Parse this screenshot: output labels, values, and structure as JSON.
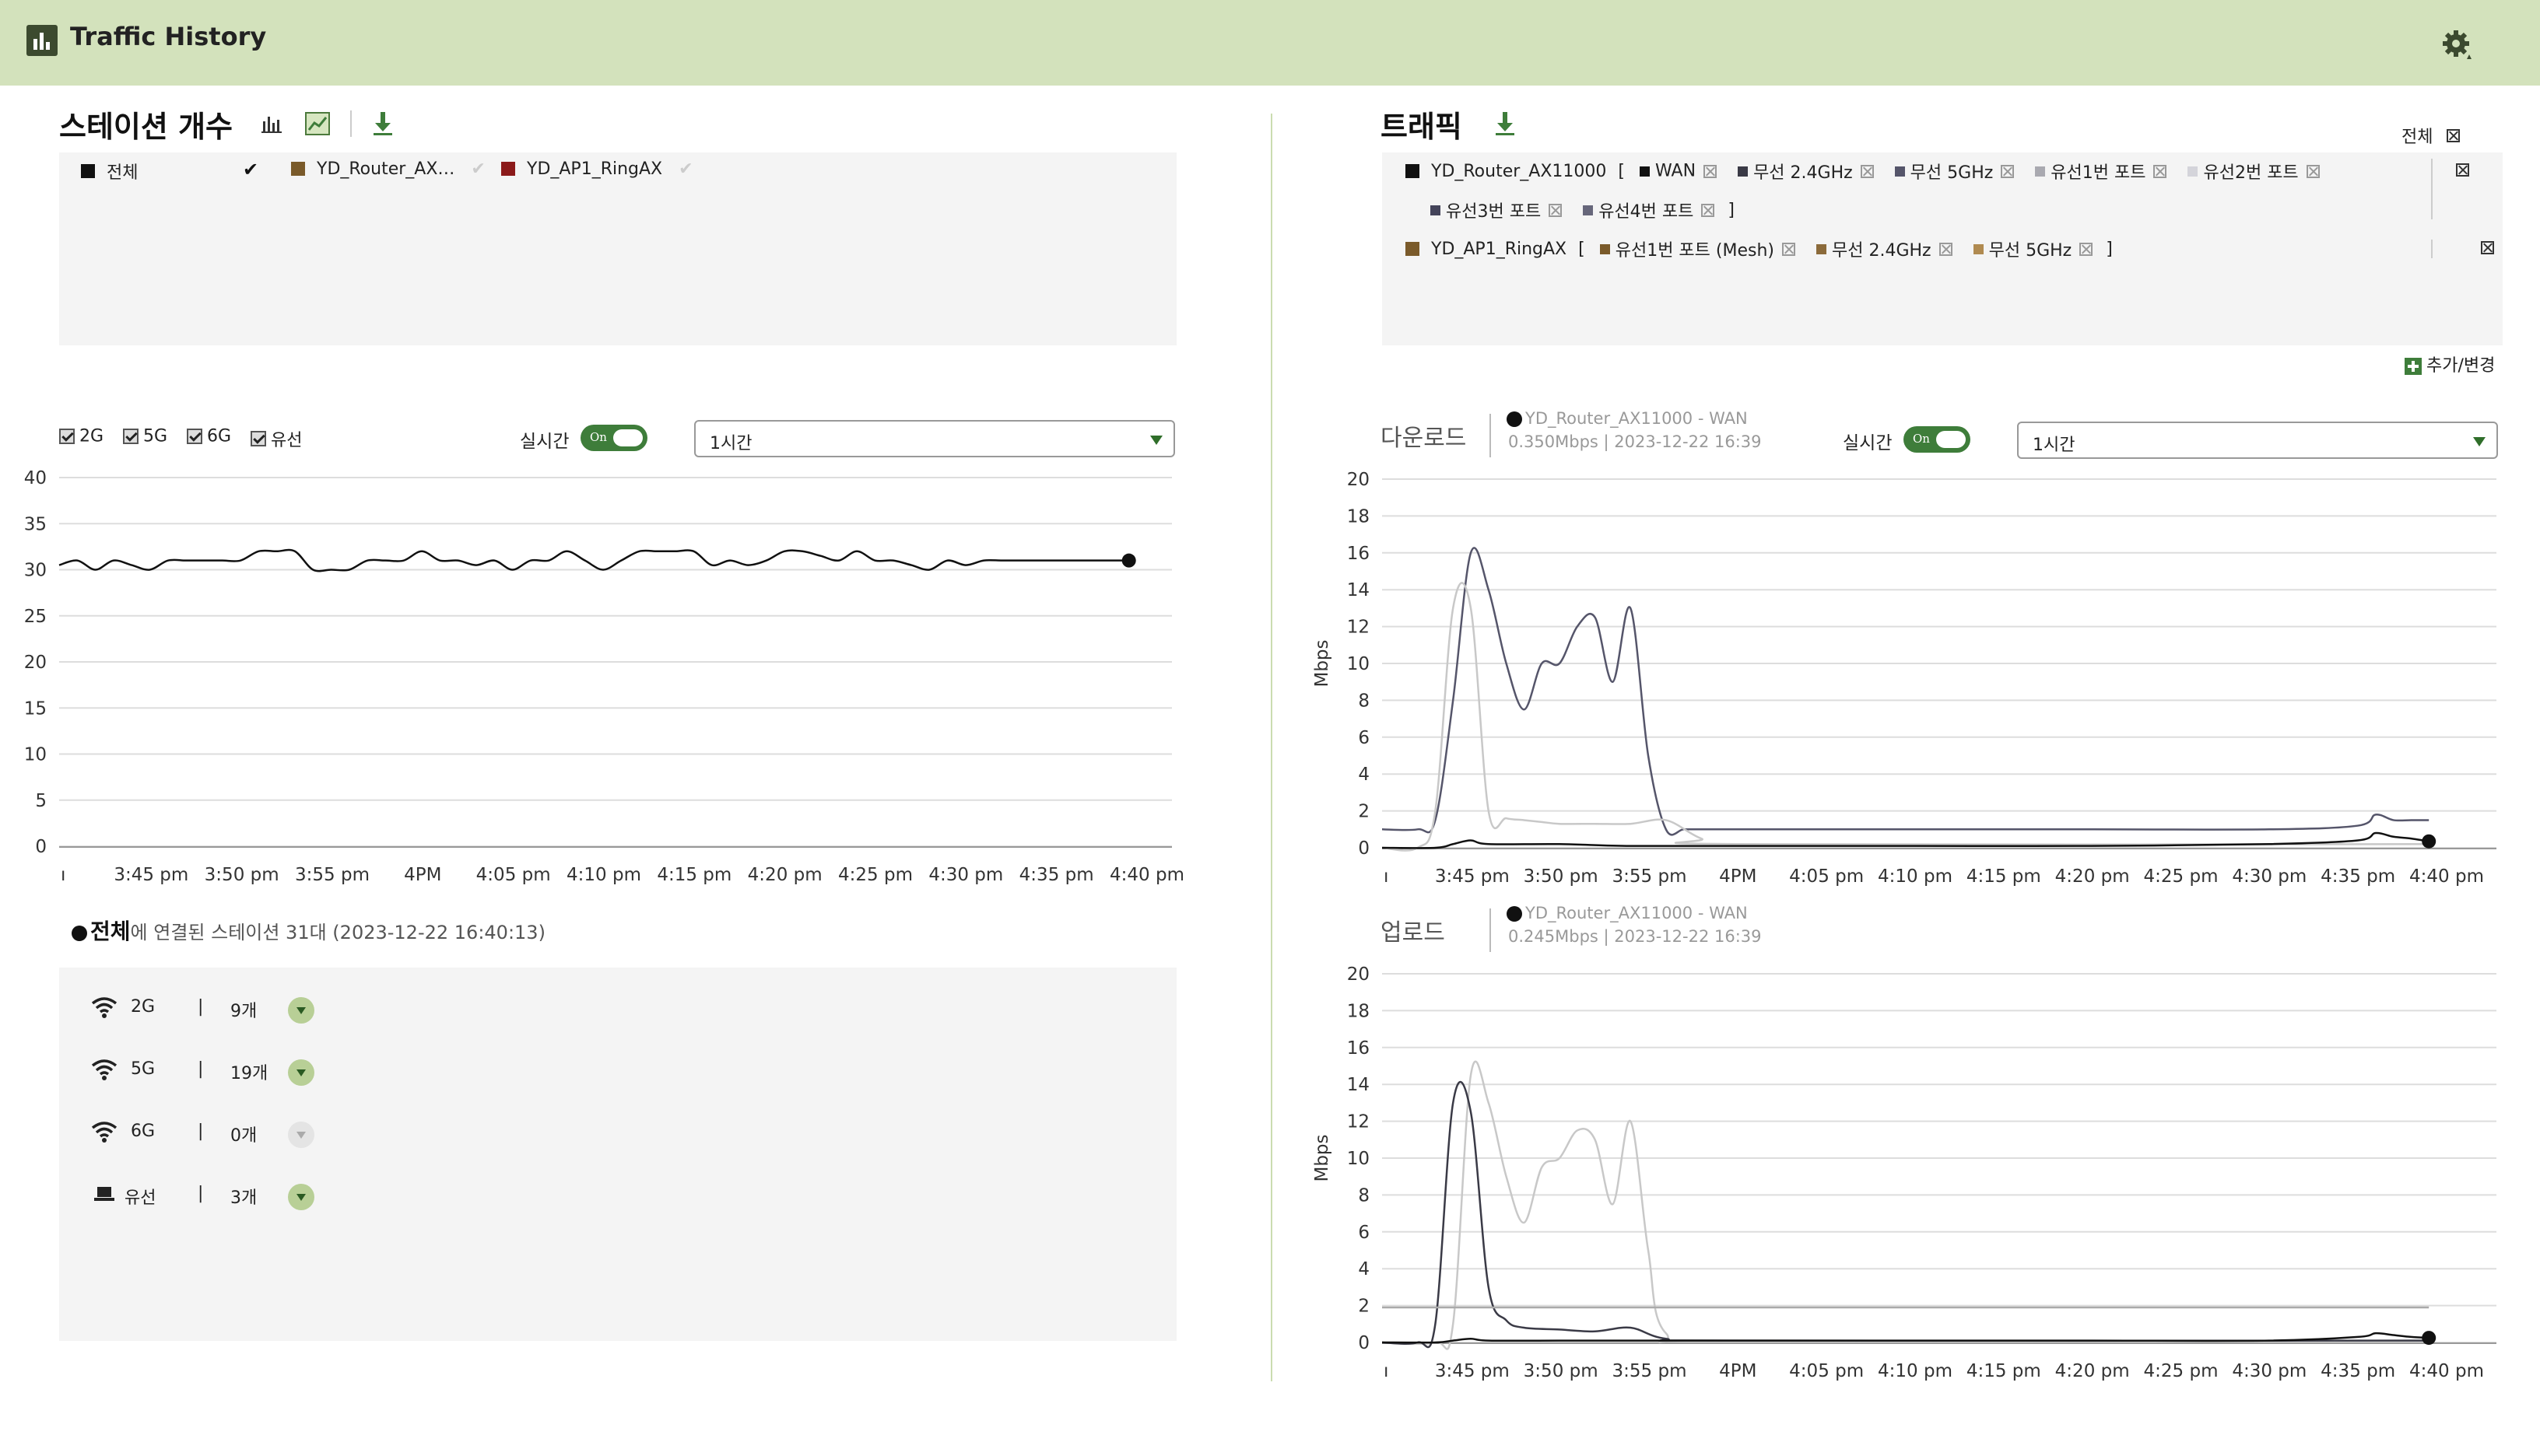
{
  "header": {
    "title": "Traffic History",
    "logo_icon": "bar-chart-icon",
    "settings_icon": "gear-icon"
  },
  "stations": {
    "title": "스테이션 개수",
    "tools": [
      "bar-chart-icon",
      "line-chart-icon",
      "download-icon"
    ],
    "legend": [
      {
        "label": "전체",
        "color": "#111111",
        "checked": true
      },
      {
        "label": "YD_Router_AX…",
        "color": "#7a5a2a",
        "checked": false
      },
      {
        "label": "YD_AP1_RingAX",
        "color": "#8b1a1a",
        "checked": false
      }
    ],
    "filters": [
      "2G",
      "5G",
      "6G",
      "유선"
    ],
    "realtime_label": "실시간",
    "toggle_text": "On",
    "range": "1시간",
    "summary_bold": "전체",
    "summary_text": "에 연결된 스테이션 31대 (2023-12-22 16:40:13)",
    "counts": [
      {
        "icon": "wifi-icon",
        "label": "2G",
        "sep": "|",
        "count": "9개",
        "enabled": true
      },
      {
        "icon": "wifi-icon",
        "label": "5G",
        "sep": "|",
        "count": "19개",
        "enabled": true
      },
      {
        "icon": "wifi-icon",
        "label": "6G",
        "sep": "|",
        "count": "0개",
        "enabled": false
      },
      {
        "icon": "laptop-icon",
        "label": "유선",
        "sep": "|",
        "count": "3개",
        "enabled": true
      }
    ]
  },
  "traffic": {
    "title": "트래픽",
    "all_label": "전체",
    "devices": [
      {
        "name": "YD_Router_AX11000",
        "color": "#111111",
        "open": "[",
        "close": "]",
        "ports": [
          {
            "label": "WAN",
            "color": "#111111"
          },
          {
            "label": "무선 2.4GHz",
            "color": "#3a3a46"
          },
          {
            "label": "무선 5GHz",
            "color": "#55556a"
          },
          {
            "label": "유선1번 포트",
            "color": "#a9a9b0"
          },
          {
            "label": "유선2번 포트",
            "color": "#d4d4da"
          },
          {
            "label": "유선3번 포트",
            "color": "#44445a"
          },
          {
            "label": "유선4번 포트",
            "color": "#66667a"
          }
        ]
      },
      {
        "name": "YD_AP1_RingAX",
        "color": "#7a5a2a",
        "open": "[",
        "close": "]",
        "ports": [
          {
            "label": "유선1번 포트 (Mesh)",
            "color": "#7a5a2a"
          },
          {
            "label": "무선 2.4GHz",
            "color": "#8b6a3a"
          },
          {
            "label": "무선 5GHz",
            "color": "#b08a50"
          }
        ]
      }
    ],
    "add_label": "추가/변경",
    "download": {
      "title": "다운로드",
      "series": "YD_Router_AX11000 - WAN",
      "value": "0.350Mbps | 2023-12-22 16:39"
    },
    "upload": {
      "title": "업로드",
      "series": "YD_Router_AX11000 - WAN",
      "value": "0.245Mbps | 2023-12-22 16:39"
    },
    "realtime_label": "실시간",
    "toggle_text": "On",
    "range": "1시간"
  },
  "chart_data": [
    {
      "type": "line",
      "x_tick_labels": [
        "ı",
        "3:45 pm",
        "3:50 pm",
        "3:55 pm",
        "4PM",
        "4:05 pm",
        "4:10 pm",
        "4:15 pm",
        "4:20 pm",
        "4:25 pm",
        "4:30 pm",
        "4:35 pm",
        "4:40 pm"
      ],
      "ylim": [
        0,
        40
      ],
      "y_ticks": [
        0,
        5,
        10,
        15,
        20,
        25,
        30,
        35,
        40
      ],
      "xlim": [
        0,
        60
      ],
      "series": [
        {
          "color": "#111111",
          "x": [
            0,
            1,
            2,
            3,
            4,
            5,
            6,
            7,
            8,
            9,
            10,
            11,
            12,
            13,
            14,
            15,
            16,
            17,
            18,
            19,
            20,
            21,
            22,
            23,
            24,
            25,
            26,
            27,
            28,
            29,
            30,
            31,
            32,
            33,
            34,
            35,
            36,
            37,
            38,
            39,
            40,
            41,
            42,
            43,
            44,
            45,
            46,
            47,
            48,
            49,
            50,
            51,
            52,
            53,
            54,
            55,
            56,
            57,
            58,
            59
          ],
          "values": [
            30.5,
            31,
            30,
            31,
            30.5,
            30,
            31,
            31,
            31,
            31,
            31,
            32,
            32,
            32,
            30,
            30,
            30,
            31,
            31,
            31,
            32,
            31,
            31,
            30.5,
            31,
            30,
            31,
            31,
            32,
            31,
            30,
            31,
            32,
            32,
            32,
            32,
            30.5,
            31,
            30.5,
            31,
            32,
            32,
            31.5,
            31,
            32,
            31,
            31,
            30.5,
            30,
            31,
            30.5,
            31,
            31,
            31,
            31,
            31,
            31,
            31,
            31,
            31
          ]
        }
      ],
      "grid": true
    },
    {
      "type": "line",
      "title": "다운로드",
      "ylabel": "Mbps",
      "x_tick_labels": [
        "ı",
        "3:45 pm",
        "3:50 pm",
        "3:55 pm",
        "4PM",
        "4:05 pm",
        "4:10 pm",
        "4:15 pm",
        "4:20 pm",
        "4:25 pm",
        "4:30 pm",
        "4:35 pm",
        "4:40 pm"
      ],
      "ylim": [
        0,
        20
      ],
      "y_ticks": [
        0,
        2,
        4,
        6,
        8,
        10,
        12,
        14,
        16,
        18,
        20
      ],
      "xlim": [
        0,
        60
      ],
      "series": [
        {
          "color": "#55556a",
          "x": [
            0,
            2,
            3,
            4,
            5,
            6,
            7,
            8,
            9,
            10,
            11,
            12,
            13,
            14,
            15,
            16,
            17,
            18,
            19,
            20,
            30,
            40,
            50,
            55,
            56,
            57,
            58,
            59
          ],
          "values": [
            1,
            1,
            1.5,
            8,
            16,
            14,
            10,
            7.5,
            10,
            10,
            12,
            12.5,
            9,
            13,
            5,
            1,
            1,
            1,
            1,
            1,
            1,
            1,
            1,
            1.2,
            1.8,
            1.5,
            1.5,
            1.5
          ]
        },
        {
          "color": "#c8c8c8",
          "x": [
            0,
            2,
            3,
            4,
            5,
            6,
            7,
            8,
            9,
            10,
            12,
            14,
            16,
            18,
            20,
            59
          ],
          "values": [
            0,
            0,
            2,
            13,
            13,
            2,
            1.6,
            1.5,
            1.4,
            1.3,
            1.3,
            1.3,
            1.5,
            0.5,
            0.2,
            0.2
          ]
        },
        {
          "color": "#111111",
          "x": [
            0,
            3,
            4,
            5,
            6,
            10,
            14,
            20,
            30,
            40,
            50,
            55,
            56,
            57,
            58,
            59
          ],
          "values": [
            0,
            0,
            0.2,
            0.4,
            0.2,
            0.2,
            0.1,
            0.1,
            0.1,
            0.1,
            0.2,
            0.4,
            0.8,
            0.6,
            0.5,
            0.35
          ]
        }
      ],
      "grid": true
    },
    {
      "type": "line",
      "title": "업로드",
      "ylabel": "Mbps",
      "x_tick_labels": [
        "ı",
        "3:45 pm",
        "3:50 pm",
        "3:55 pm",
        "4PM",
        "4:05 pm",
        "4:10 pm",
        "4:15 pm",
        "4:20 pm",
        "4:25 pm",
        "4:30 pm",
        "4:35 pm",
        "4:40 pm"
      ],
      "ylim": [
        0,
        20
      ],
      "y_ticks": [
        0,
        2,
        4,
        6,
        8,
        10,
        12,
        14,
        16,
        18,
        20
      ],
      "xlim": [
        0,
        60
      ],
      "series": [
        {
          "color": "#c8c8c8",
          "x": [
            0,
            3,
            4,
            5,
            6,
            7,
            8,
            9,
            10,
            11,
            12,
            13,
            14,
            15,
            16,
            20,
            59
          ],
          "values": [
            0,
            0,
            1,
            14.5,
            13,
            9,
            6.5,
            9.5,
            10,
            11.5,
            11,
            7.5,
            12,
            5,
            0.5,
            0.1,
            0.1
          ]
        },
        {
          "color": "#3a3a46",
          "x": [
            0,
            2,
            3,
            4,
            5,
            6,
            7,
            8,
            10,
            12,
            14,
            16,
            20,
            59
          ],
          "values": [
            0,
            0,
            1,
            13,
            12.5,
            3,
            1.2,
            0.8,
            0.7,
            0.6,
            0.8,
            0.2,
            0.1,
            0.1
          ]
        },
        {
          "color": "#aaaaaa",
          "x": [
            0,
            10,
            20,
            30,
            40,
            50,
            59
          ],
          "values": [
            1.9,
            1.9,
            1.9,
            1.9,
            1.9,
            1.9,
            1.9
          ]
        },
        {
          "color": "#111111",
          "x": [
            0,
            3,
            4,
            5,
            6,
            10,
            14,
            20,
            30,
            40,
            50,
            55,
            56,
            57,
            58,
            59
          ],
          "values": [
            0,
            0,
            0.1,
            0.2,
            0.1,
            0.1,
            0.1,
            0.1,
            0.1,
            0.1,
            0.1,
            0.3,
            0.5,
            0.4,
            0.3,
            0.25
          ]
        }
      ],
      "grid": true
    }
  ]
}
